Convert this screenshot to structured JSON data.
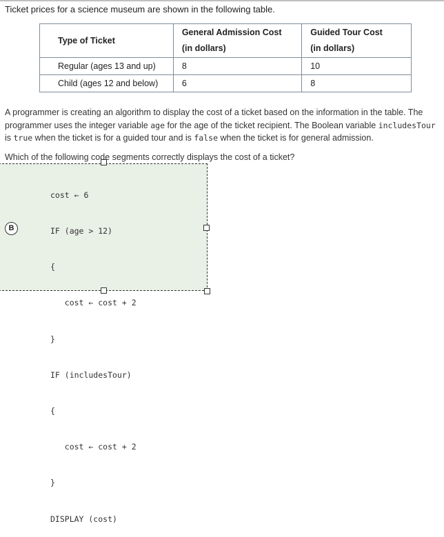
{
  "intro": "Ticket prices for a science museum are shown in the following table.",
  "table": {
    "headers": [
      "Type of Ticket",
      "General Admission Cost",
      "(in dollars)",
      "Guided Tour Cost",
      "(in dollars)"
    ],
    "rows": [
      [
        "Regular (ages 13 and up)",
        "8",
        "10"
      ],
      [
        "Child (ages 12 and below)",
        "6",
        "8"
      ]
    ]
  },
  "paragraph": {
    "p1": "A programmer is creating an algorithm to display the cost of a ticket based on the information in the table. The programmer uses the integer variable ",
    "c1": "age",
    "p2": " for the age of the ticket recipient. The Boolean variable ",
    "c2": "includesTour",
    "p3": "is ",
    "c3": "true",
    "p4": " when the ticket is for a guided tour and is ",
    "c4": "false",
    "p5": " when the ticket is for general admission."
  },
  "question": "Which of the following code segments correctly displays the cost of a ticket?",
  "option": {
    "letter": "B",
    "code_lines": [
      "cost ← 6",
      "IF (age > 12)",
      "{",
      "   cost ← cost + 2",
      "}",
      "IF (includesTour)",
      "{",
      "   cost ← cost + 2",
      "}",
      "DISPLAY (cost)"
    ]
  }
}
